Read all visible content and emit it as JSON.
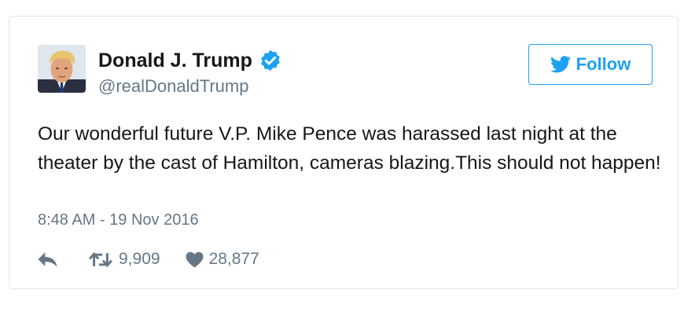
{
  "tweet": {
    "user": {
      "display_name": "Donald J. Trump",
      "handle": "@realDonaldTrump",
      "verified": true,
      "avatar_icon": "profile-photo"
    },
    "follow_label": "Follow",
    "text": "Our wonderful future V.P. Mike Pence was harassed last night at the theater by the cast of Hamilton, cameras blazing.This should not happen!",
    "timestamp": "8:48 AM - 19 Nov 2016",
    "actions": {
      "reply_icon": "reply-icon",
      "retweet_icon": "retweet-icon",
      "retweet_count": "9,909",
      "like_icon": "heart-icon",
      "like_count": "28,877"
    }
  },
  "colors": {
    "accent": "#1da1f2",
    "text": "#14171a",
    "muted": "#657786",
    "border": "#e1e8ed"
  }
}
